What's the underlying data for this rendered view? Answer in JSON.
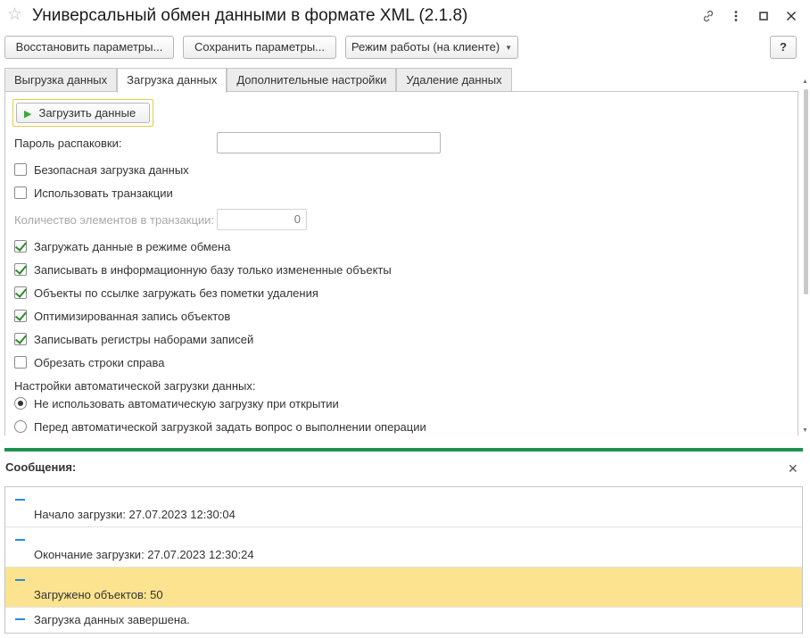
{
  "window": {
    "title": "Универсальный обмен данными в формате XML (2.1.8)",
    "favorite_icon": "star-icon",
    "actions": [
      "link-icon",
      "more-icon",
      "maximize-icon",
      "close-icon"
    ]
  },
  "toolbar": {
    "restore_label": "Восстановить параметры...",
    "save_label": "Сохранить параметры...",
    "mode_label": "Режим работы (на клиенте)",
    "help_label": "?"
  },
  "tabs": [
    {
      "label": "Выгрузка данных",
      "active": false
    },
    {
      "label": "Загрузка данных",
      "active": true
    },
    {
      "label": "Дополнительные настройки",
      "active": false
    },
    {
      "label": "Удаление данных",
      "active": false
    }
  ],
  "load": {
    "load_button_label": "Загрузить данные",
    "password_label": "Пароль распаковки:",
    "password_value": "",
    "safe_load_label": "Безопасная загрузка данных",
    "safe_load_checked": false,
    "use_transactions_label": "Использовать транзакции",
    "use_transactions_checked": false,
    "transaction_count_label": "Количество элементов в транзакции:",
    "transaction_count_value": "0",
    "options": [
      {
        "label": "Загружать данные в режиме обмена",
        "checked": true
      },
      {
        "label": "Записывать в информационную базу только измененные объекты",
        "checked": true
      },
      {
        "label": "Объекты по ссылке загружать без пометки удаления",
        "checked": true
      },
      {
        "label": "Оптимизированная запись объектов",
        "checked": true
      },
      {
        "label": "Записывать регистры наборами записей",
        "checked": true
      },
      {
        "label": "Обрезать строки справа",
        "checked": false
      }
    ],
    "auto_load_label": "Настройки автоматической загрузки данных:",
    "auto_load_options": [
      {
        "label": "Не использовать автоматическую загрузку при открытии",
        "selected": true
      },
      {
        "label": "Перед автоматической загрузкой задать вопрос о выполнении операции",
        "selected": false
      }
    ]
  },
  "messages": {
    "title": "Сообщения:",
    "items": [
      {
        "text": "Начало загрузки: 27.07.2023 12:30:04",
        "highlighted": false
      },
      {
        "text": "Окончание загрузки: 27.07.2023 12:30:24",
        "highlighted": false
      },
      {
        "text": "Загружено объектов: 50",
        "highlighted": true
      },
      {
        "text": "Загрузка данных завершена.",
        "highlighted": false
      }
    ]
  },
  "colors": {
    "accent_green": "#1e9150",
    "highlight_yellow": "#fbe390",
    "dash_blue": "#2a8bd1"
  }
}
